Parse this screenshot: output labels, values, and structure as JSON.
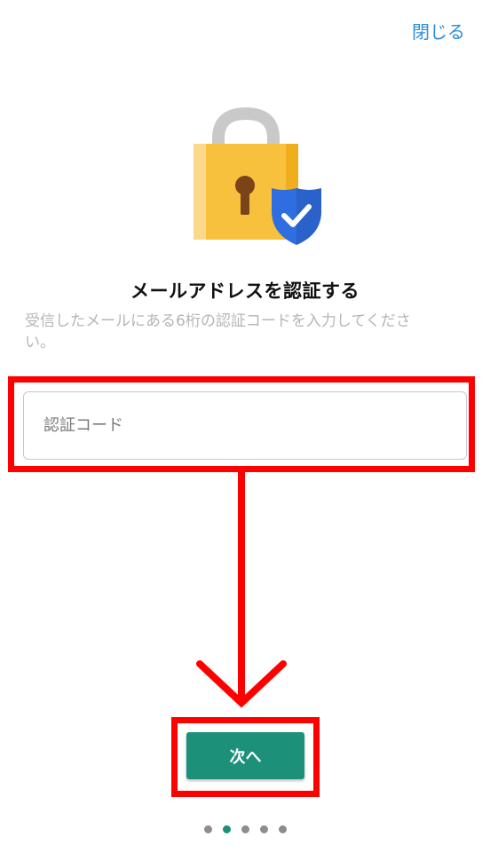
{
  "header": {
    "close_label": "閉じる"
  },
  "main": {
    "title": "メールアドレスを認証する",
    "subtitle": "受信したメールにある6桁の認証コードを入力してください。",
    "code_input": {
      "placeholder": "認証コード",
      "value": ""
    },
    "next_label": "次へ"
  },
  "pager": {
    "count": 5,
    "active_index": 1
  },
  "colors": {
    "accent": "#1c9079",
    "link": "#2b8fd9",
    "annotation": "#ff0000",
    "lock_body": "#f7c13d",
    "shield": "#2f6ee0"
  },
  "icons": {
    "hero": "padlock-icon",
    "badge": "shield-check-icon"
  }
}
